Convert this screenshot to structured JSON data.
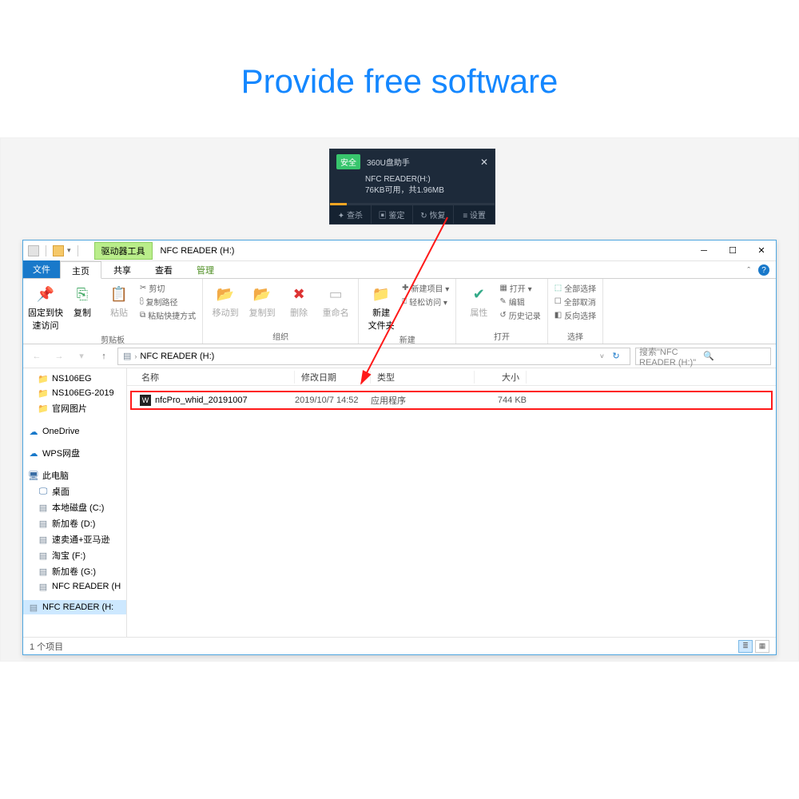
{
  "headline": "Provide free software",
  "popup": {
    "title": "360U盘助手",
    "badge": "安全",
    "deviceLine": "NFC READER(H:)",
    "spaceLine": "76KB可用，共1.96MB",
    "tabs": [
      "✦ 查杀",
      "▣ 鉴定",
      "↻ 恢复",
      "≡ 设置"
    ]
  },
  "window": {
    "driveTools": "驱动器工具",
    "title": "NFC READER (H:)",
    "tabs": {
      "file": "文件",
      "home": "主页",
      "share": "共享",
      "view": "查看",
      "manage": "管理"
    }
  },
  "ribbon": {
    "pinQuick": "固定到快\n速访问",
    "copy": "复制",
    "paste": "粘贴",
    "cut": "剪切",
    "copyPath": "复制路径",
    "pasteShortcut": "粘贴快捷方式",
    "clipboardGroup": "剪贴板",
    "moveTo": "移动到",
    "copyTo": "复制到",
    "delete": "删除",
    "rename": "重命名",
    "organizeGroup": "组织",
    "newFolder": "新建\n文件夹",
    "newItem": "新建项目 ▾",
    "easyAccess": "轻松访问 ▾",
    "newGroup": "新建",
    "properties": "属性",
    "open": "打开 ▾",
    "edit": "编辑",
    "history": "历史记录",
    "openGroup": "打开",
    "selectAll": "全部选择",
    "selectNone": "全部取消",
    "invert": "反向选择",
    "selectGroup": "选择"
  },
  "addressbar": {
    "segment": "NFC READER (H:)",
    "searchPlaceholder": "搜索\"NFC READER (H:)\""
  },
  "columns": {
    "name": "名称",
    "date": "修改日期",
    "type": "类型",
    "size": "大小"
  },
  "nav": {
    "folders": [
      "NS106EG",
      "NS106EG-2019",
      "官网图片"
    ],
    "onedrive": "OneDrive",
    "wps": "WPS网盘",
    "pc": "此电脑",
    "desktop": "桌面",
    "drives": [
      "本地磁盘 (C:)",
      "新加卷 (D:)",
      "速卖通+亚马逊",
      "淘宝 (F:)",
      "新加卷 (G:)",
      "NFC READER (H"
    ],
    "selected": "NFC READER (H:"
  },
  "file": {
    "name": "nfcPro_whid_20191007",
    "date": "2019/10/7 14:52",
    "type": "应用程序",
    "size": "744 KB"
  },
  "status": "1 个项目"
}
